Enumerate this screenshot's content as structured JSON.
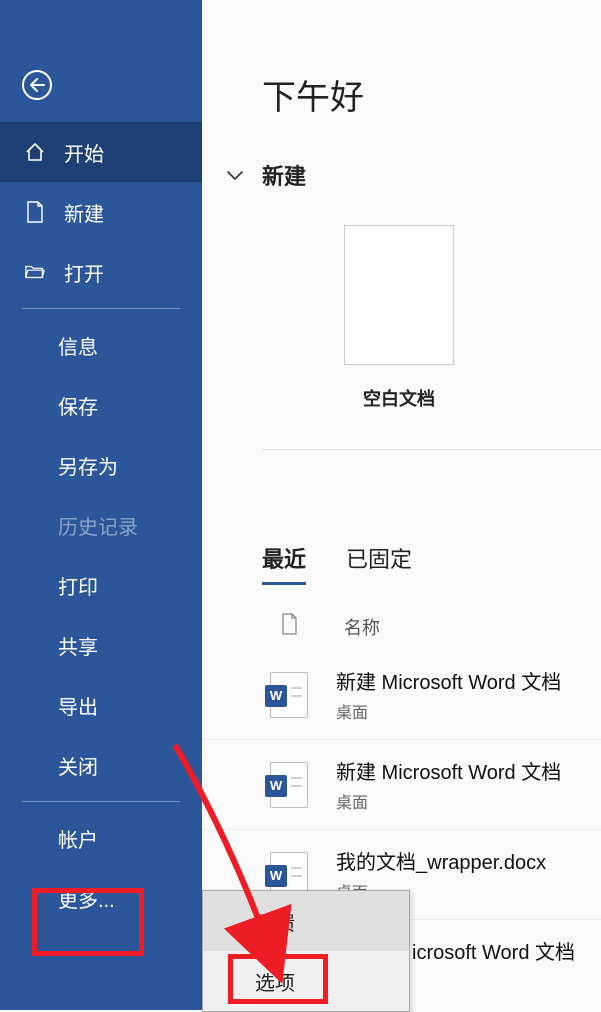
{
  "sidebar": {
    "items": [
      {
        "label": "开始"
      },
      {
        "label": "新建"
      },
      {
        "label": "打开"
      },
      {
        "label": "信息"
      },
      {
        "label": "保存"
      },
      {
        "label": "另存为"
      },
      {
        "label": "历史记录"
      },
      {
        "label": "打印"
      },
      {
        "label": "共享"
      },
      {
        "label": "导出"
      },
      {
        "label": "关闭"
      },
      {
        "label": "帐户"
      },
      {
        "label": "更多..."
      }
    ]
  },
  "main": {
    "greeting": "下午好",
    "new_section": "新建",
    "template_label": "空白文档",
    "tabs": {
      "recent": "最近",
      "pinned": "已固定"
    },
    "list_header": {
      "name_col": "名称"
    },
    "files": [
      {
        "name": "新建 Microsoft Word 文档",
        "location": "桌面"
      },
      {
        "name": "新建 Microsoft Word 文档",
        "location": "桌面"
      },
      {
        "name": "我的文档_wrapper.docx",
        "location": "桌面"
      },
      {
        "name": "icrosoft Word 文档",
        "location": ""
      }
    ]
  },
  "popup": {
    "feedback": "反馈",
    "options": "选项"
  }
}
